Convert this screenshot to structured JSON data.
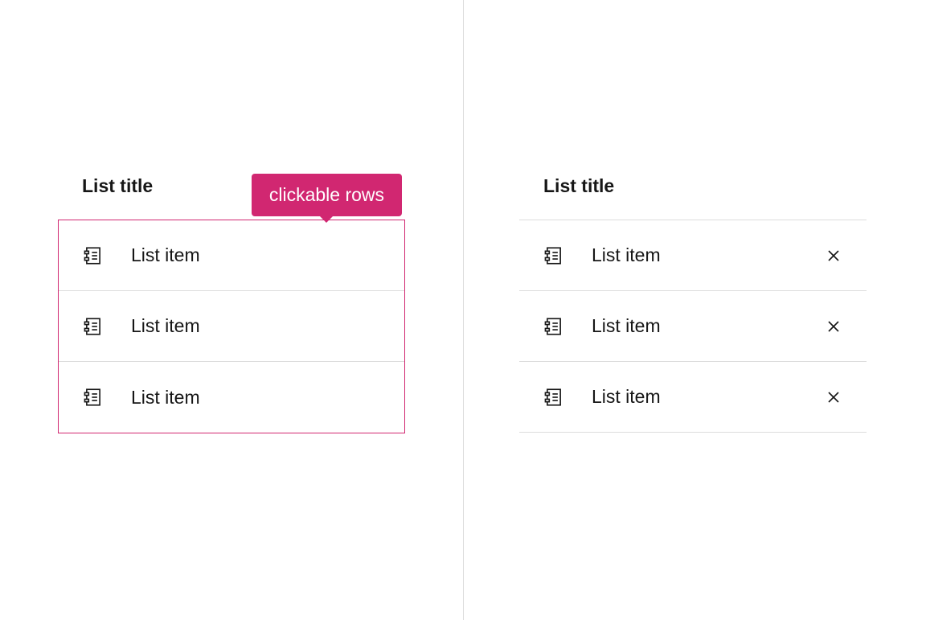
{
  "colors": {
    "accent": "#d12771",
    "divider": "#dcdcdc",
    "text": "#161616"
  },
  "left_list": {
    "title": "List title",
    "tooltip": "clickable rows",
    "items": [
      {
        "label": "List item"
      },
      {
        "label": "List item"
      },
      {
        "label": "List item"
      }
    ]
  },
  "right_list": {
    "title": "List title",
    "items": [
      {
        "label": "List item"
      },
      {
        "label": "List item"
      },
      {
        "label": "List item"
      }
    ]
  },
  "icons": {
    "item": "clipboard-list-icon",
    "close": "close-icon"
  }
}
